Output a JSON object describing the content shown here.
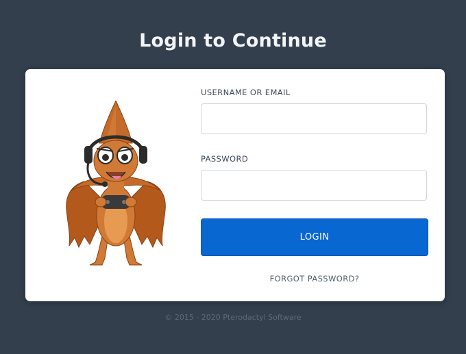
{
  "page": {
    "title": "Login to Continue"
  },
  "form": {
    "username_label": "USERNAME OR EMAIL",
    "username_value": "",
    "password_label": "PASSWORD",
    "password_value": "",
    "login_label": "LOGIN",
    "forgot_label": "FORGOT PASSWORD?"
  },
  "footer": {
    "text": "© 2015 - 2020 Pterodactyl Software"
  },
  "icons": {
    "mascot": "pterodactyl-gamer-mascot"
  },
  "colors": {
    "background": "#333f4d",
    "primary": "#0967d2",
    "mascot_body": "#c46a2a"
  }
}
